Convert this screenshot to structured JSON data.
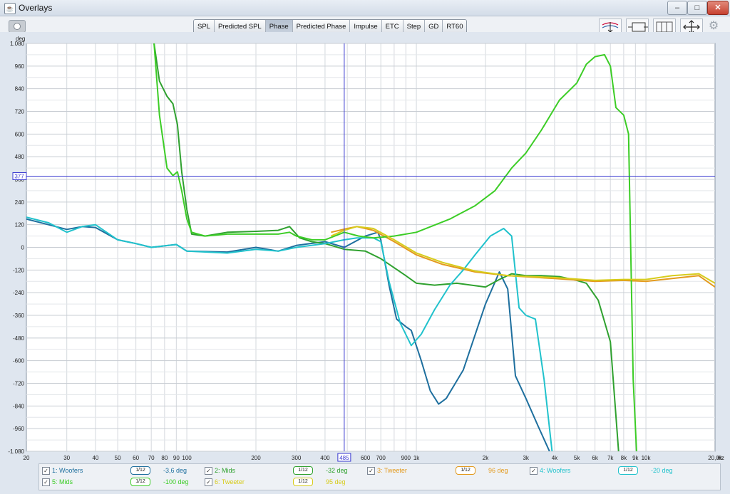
{
  "window": {
    "title": "Overlays",
    "minimize_glyph": "–",
    "maximize_glyph": "□",
    "close_glyph": "✕"
  },
  "toolbar": {
    "tabs": [
      "SPL",
      "Predicted SPL",
      "Phase",
      "Predicted Phase",
      "Impulse",
      "ETC",
      "Step",
      "GD",
      "RT60"
    ],
    "active_tab": "Phase",
    "icons": [
      "camera-icon",
      "vertical-scale-icon",
      "horizontal-limits-icon",
      "grid-icon",
      "fit-axes-icon",
      "settings-gear-icon"
    ]
  },
  "chart_data": {
    "type": "line",
    "title": "",
    "y_unit_label": "deg",
    "x_unit_label": "Hz",
    "x_scale": "log",
    "xlim": [
      20,
      20000
    ],
    "ylim": [
      -1080,
      1080
    ],
    "grid": true,
    "x_ticks": [
      {
        "v": 20,
        "t": "20"
      },
      {
        "v": 30,
        "t": "30"
      },
      {
        "v": 40,
        "t": "40"
      },
      {
        "v": 50,
        "t": "50"
      },
      {
        "v": 60,
        "t": "60"
      },
      {
        "v": 70,
        "t": "70"
      },
      {
        "v": 80,
        "t": "80"
      },
      {
        "v": 90,
        "t": "90"
      },
      {
        "v": 100,
        "t": "100"
      },
      {
        "v": 200,
        "t": "200"
      },
      {
        "v": 300,
        "t": "300"
      },
      {
        "v": 400,
        "t": "400"
      },
      {
        "v": 600,
        "t": "600"
      },
      {
        "v": 700,
        "t": "700"
      },
      {
        "v": 900,
        "t": "900"
      },
      {
        "v": 1000,
        "t": "1k"
      },
      {
        "v": 2000,
        "t": "2k"
      },
      {
        "v": 3000,
        "t": "3k"
      },
      {
        "v": 4000,
        "t": "4k"
      },
      {
        "v": 5000,
        "t": "5k"
      },
      {
        "v": 6000,
        "t": "6k"
      },
      {
        "v": 7000,
        "t": "7k"
      },
      {
        "v": 8000,
        "t": "8k"
      },
      {
        "v": 9000,
        "t": "9k"
      },
      {
        "v": 10000,
        "t": "10k"
      },
      {
        "v": 20000,
        "t": "20,0k"
      }
    ],
    "y_ticks": [
      {
        "v": 1080,
        "t": "1.080"
      },
      {
        "v": 960,
        "t": "960"
      },
      {
        "v": 840,
        "t": "840"
      },
      {
        "v": 720,
        "t": "720"
      },
      {
        "v": 600,
        "t": "600"
      },
      {
        "v": 480,
        "t": "480"
      },
      {
        "v": 360,
        "t": "360"
      },
      {
        "v": 240,
        "t": "240"
      },
      {
        "v": 120,
        "t": "120"
      },
      {
        "v": 0,
        "t": "0"
      },
      {
        "v": -120,
        "t": "-120"
      },
      {
        "v": -240,
        "t": "-240"
      },
      {
        "v": -360,
        "t": "-360"
      },
      {
        "v": -480,
        "t": "-480"
      },
      {
        "v": -600,
        "t": "-600"
      },
      {
        "v": -720,
        "t": "-720"
      },
      {
        "v": -840,
        "t": "-840"
      },
      {
        "v": -960,
        "t": "-960"
      },
      {
        "v": -1080,
        "t": "-1.080"
      }
    ],
    "cursor": {
      "x": 485,
      "y": 377,
      "x_label": "485",
      "y_label": "377",
      "color": "#3a3ad0"
    },
    "series": [
      {
        "name": "1: Woofers",
        "color": "#1e6f9e",
        "width": 2,
        "points": [
          [
            20,
            150
          ],
          [
            25,
            120
          ],
          [
            30,
            95
          ],
          [
            35,
            110
          ],
          [
            40,
            105
          ],
          [
            50,
            40
          ],
          [
            60,
            20
          ],
          [
            70,
            0
          ],
          [
            90,
            15
          ],
          [
            100,
            -20
          ],
          [
            150,
            -25
          ],
          [
            200,
            0
          ],
          [
            250,
            -20
          ],
          [
            300,
            10
          ],
          [
            400,
            30
          ],
          [
            485,
            0
          ],
          [
            600,
            60
          ],
          [
            680,
            80
          ],
          [
            700,
            40
          ],
          [
            760,
            -200
          ],
          [
            820,
            -380
          ],
          [
            900,
            -420
          ],
          [
            950,
            -440
          ],
          [
            1050,
            -600
          ],
          [
            1150,
            -760
          ],
          [
            1250,
            -830
          ],
          [
            1350,
            -800
          ],
          [
            1600,
            -650
          ],
          [
            2000,
            -300
          ],
          [
            2300,
            -130
          ],
          [
            2500,
            -220
          ],
          [
            2700,
            -680
          ],
          [
            3000,
            -800
          ],
          [
            3400,
            -950
          ],
          [
            3800,
            -1080
          ]
        ]
      },
      {
        "name": "2: Mids",
        "color": "#2fa12f",
        "width": 2,
        "points": [
          [
            72,
            1080
          ],
          [
            76,
            880
          ],
          [
            82,
            800
          ],
          [
            87,
            760
          ],
          [
            91,
            650
          ],
          [
            95,
            400
          ],
          [
            100,
            200
          ],
          [
            105,
            70
          ],
          [
            120,
            60
          ],
          [
            150,
            80
          ],
          [
            200,
            85
          ],
          [
            250,
            90
          ],
          [
            280,
            110
          ],
          [
            310,
            50
          ],
          [
            350,
            30
          ],
          [
            400,
            20
          ],
          [
            485,
            -10
          ],
          [
            600,
            -20
          ],
          [
            700,
            -60
          ],
          [
            900,
            -150
          ],
          [
            1000,
            -190
          ],
          [
            1200,
            -200
          ],
          [
            1500,
            -190
          ],
          [
            2000,
            -210
          ],
          [
            2300,
            -170
          ],
          [
            2600,
            -140
          ],
          [
            3000,
            -150
          ],
          [
            3500,
            -150
          ],
          [
            4200,
            -155
          ],
          [
            5000,
            -175
          ],
          [
            5500,
            -190
          ],
          [
            6200,
            -280
          ],
          [
            7000,
            -500
          ],
          [
            7600,
            -1080
          ]
        ]
      },
      {
        "name": "3: Tweeter",
        "color": "#e39a1d",
        "width": 2,
        "points": [
          [
            425,
            80
          ],
          [
            500,
            100
          ],
          [
            550,
            110
          ],
          [
            650,
            90
          ],
          [
            800,
            30
          ],
          [
            1000,
            -40
          ],
          [
            1300,
            -90
          ],
          [
            1800,
            -130
          ],
          [
            2500,
            -150
          ],
          [
            4000,
            -165
          ],
          [
            6000,
            -180
          ],
          [
            8000,
            -175
          ],
          [
            10000,
            -180
          ],
          [
            13000,
            -165
          ],
          [
            17000,
            -150
          ],
          [
            20000,
            -210
          ]
        ]
      },
      {
        "name": "4: Woofers",
        "color": "#21c2cc",
        "width": 2,
        "points": [
          [
            20,
            160
          ],
          [
            25,
            130
          ],
          [
            30,
            80
          ],
          [
            35,
            110
          ],
          [
            40,
            120
          ],
          [
            50,
            40
          ],
          [
            60,
            20
          ],
          [
            70,
            0
          ],
          [
            90,
            15
          ],
          [
            100,
            -20
          ],
          [
            150,
            -30
          ],
          [
            200,
            -10
          ],
          [
            250,
            -20
          ],
          [
            300,
            0
          ],
          [
            400,
            20
          ],
          [
            485,
            40
          ],
          [
            550,
            50
          ],
          [
            650,
            50
          ],
          [
            700,
            30
          ],
          [
            760,
            -180
          ],
          [
            850,
            -400
          ],
          [
            950,
            -520
          ],
          [
            1050,
            -460
          ],
          [
            1200,
            -330
          ],
          [
            1400,
            -200
          ],
          [
            1600,
            -120
          ],
          [
            1800,
            -40
          ],
          [
            2100,
            60
          ],
          [
            2400,
            100
          ],
          [
            2600,
            60
          ],
          [
            2800,
            -320
          ],
          [
            3000,
            -360
          ],
          [
            3300,
            -380
          ],
          [
            3600,
            -700
          ],
          [
            3900,
            -1080
          ]
        ]
      },
      {
        "name": "5: Mids",
        "color": "#3ccd26",
        "width": 2,
        "points": [
          [
            72,
            1080
          ],
          [
            76,
            700
          ],
          [
            82,
            420
          ],
          [
            87,
            380
          ],
          [
            91,
            400
          ],
          [
            95,
            300
          ],
          [
            100,
            150
          ],
          [
            105,
            80
          ],
          [
            120,
            60
          ],
          [
            150,
            70
          ],
          [
            200,
            70
          ],
          [
            250,
            70
          ],
          [
            280,
            80
          ],
          [
            300,
            60
          ],
          [
            350,
            40
          ],
          [
            400,
            40
          ],
          [
            485,
            80
          ],
          [
            560,
            60
          ],
          [
            650,
            50
          ],
          [
            800,
            60
          ],
          [
            1000,
            80
          ],
          [
            1400,
            150
          ],
          [
            1800,
            220
          ],
          [
            2200,
            300
          ],
          [
            2600,
            420
          ],
          [
            3000,
            500
          ],
          [
            3500,
            620
          ],
          [
            4200,
            780
          ],
          [
            5000,
            870
          ],
          [
            5500,
            970
          ],
          [
            6000,
            1010
          ],
          [
            6600,
            1020
          ],
          [
            7000,
            960
          ],
          [
            7400,
            740
          ],
          [
            8000,
            700
          ],
          [
            8400,
            600
          ],
          [
            8800,
            -700
          ],
          [
            9100,
            -1080
          ]
        ]
      },
      {
        "name": "6: Tweeter",
        "color": "#d7cc1c",
        "width": 2,
        "points": [
          [
            425,
            60
          ],
          [
            485,
            90
          ],
          [
            550,
            110
          ],
          [
            650,
            100
          ],
          [
            800,
            40
          ],
          [
            1000,
            -30
          ],
          [
            1300,
            -80
          ],
          [
            1800,
            -125
          ],
          [
            2500,
            -150
          ],
          [
            4000,
            -160
          ],
          [
            6000,
            -175
          ],
          [
            8000,
            -170
          ],
          [
            10000,
            -170
          ],
          [
            13000,
            -150
          ],
          [
            17000,
            -140
          ],
          [
            20000,
            -190
          ]
        ]
      }
    ]
  },
  "legend": [
    {
      "label": "1: Woofers",
      "smoothing": "1/12",
      "value": "-3,6 deg",
      "color": "#1e6f9e",
      "checked": true
    },
    {
      "label": "2: Mids",
      "smoothing": "1/12",
      "value": "-32 deg",
      "color": "#2fa12f",
      "checked": true
    },
    {
      "label": "3: Tweeter",
      "smoothing": "1/12",
      "value": "96 deg",
      "color": "#e39a1d",
      "checked": true
    },
    {
      "label": "4: Woofers",
      "smoothing": "1/12",
      "value": "-20 deg",
      "color": "#21c2cc",
      "checked": true
    },
    {
      "label": "5: Mids",
      "smoothing": "1/12",
      "value": "-100 deg",
      "color": "#3ccd26",
      "checked": true
    },
    {
      "label": "6: Tweeter",
      "smoothing": "1/12",
      "value": "95 deg",
      "color": "#d7cc1c",
      "checked": true
    }
  ]
}
